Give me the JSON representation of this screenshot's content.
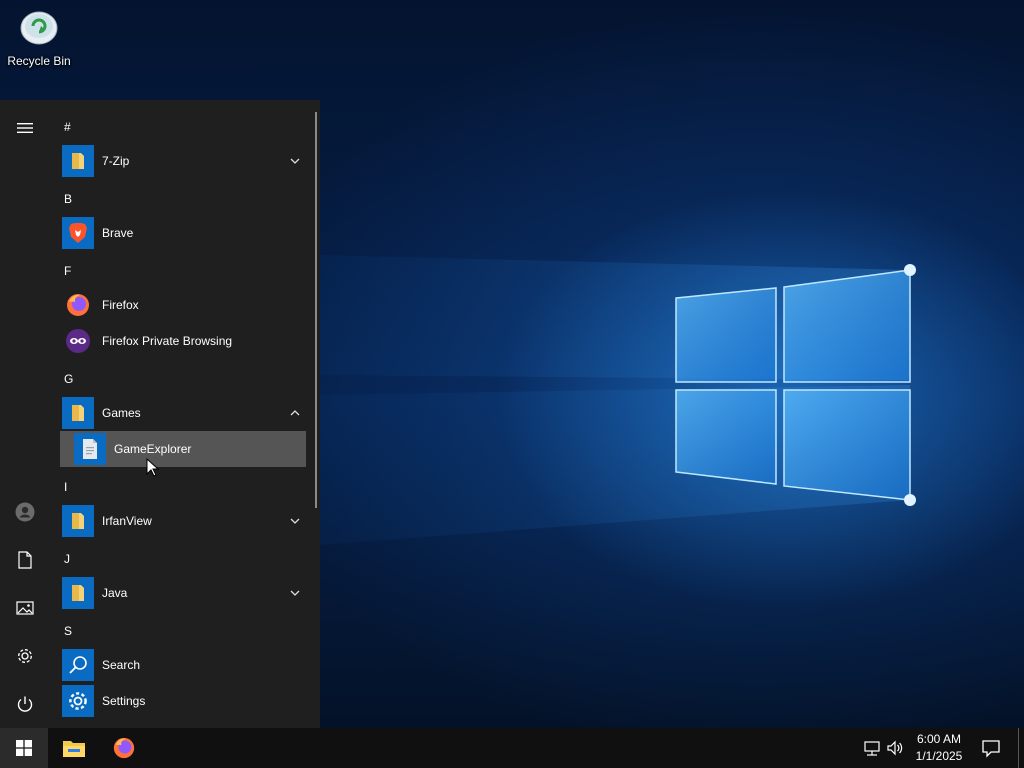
{
  "desktop": {
    "icons": [
      {
        "label": "Recycle Bin",
        "icon": "recycle-bin-icon"
      }
    ]
  },
  "start_menu": {
    "rail": {
      "items": [
        {
          "name": "expand",
          "icon": "hamburger-icon"
        },
        {
          "name": "account",
          "icon": "user-avatar-icon"
        },
        {
          "name": "documents",
          "icon": "document-icon"
        },
        {
          "name": "pictures",
          "icon": "pictures-icon"
        },
        {
          "name": "settings",
          "icon": "gear-icon"
        },
        {
          "name": "power",
          "icon": "power-icon"
        }
      ]
    },
    "sections": [
      {
        "header": "#",
        "apps": [
          {
            "label": "7-Zip",
            "icon": "folder-icon",
            "expandable": "collapsed"
          }
        ]
      },
      {
        "header": "B",
        "apps": [
          {
            "label": "Brave",
            "icon": "brave-icon"
          }
        ]
      },
      {
        "header": "F",
        "apps": [
          {
            "label": "Firefox",
            "icon": "firefox-icon"
          },
          {
            "label": "Firefox Private Browsing",
            "icon": "firefox-private-icon"
          }
        ]
      },
      {
        "header": "G",
        "apps": [
          {
            "label": "Games",
            "icon": "folder-icon",
            "expandable": "expanded",
            "children": [
              {
                "label": "GameExplorer",
                "icon": "document-app-icon",
                "state": "hover"
              }
            ]
          }
        ]
      },
      {
        "header": "I",
        "apps": [
          {
            "label": "IrfanView",
            "icon": "folder-icon",
            "expandable": "collapsed"
          }
        ]
      },
      {
        "header": "J",
        "apps": [
          {
            "label": "Java",
            "icon": "folder-icon",
            "expandable": "collapsed"
          }
        ]
      },
      {
        "header": "S",
        "apps": [
          {
            "label": "Search",
            "icon": "search-icon"
          },
          {
            "label": "Settings",
            "icon": "gear-icon"
          }
        ]
      }
    ]
  },
  "taskbar": {
    "pinned": [
      {
        "name": "file-explorer",
        "icon": "file-explorer-icon"
      },
      {
        "name": "firefox",
        "icon": "firefox-icon"
      }
    ],
    "tray": {
      "icons": [
        "network-icon",
        "volume-icon"
      ],
      "time": "6:00 AM",
      "date": "1/1/2025"
    }
  },
  "colors": {
    "tile_blue": "#0a6bc2",
    "menu_bg": "#1f1f1f",
    "taskbar_bg": "#101010",
    "hover_bg": "#555555"
  }
}
